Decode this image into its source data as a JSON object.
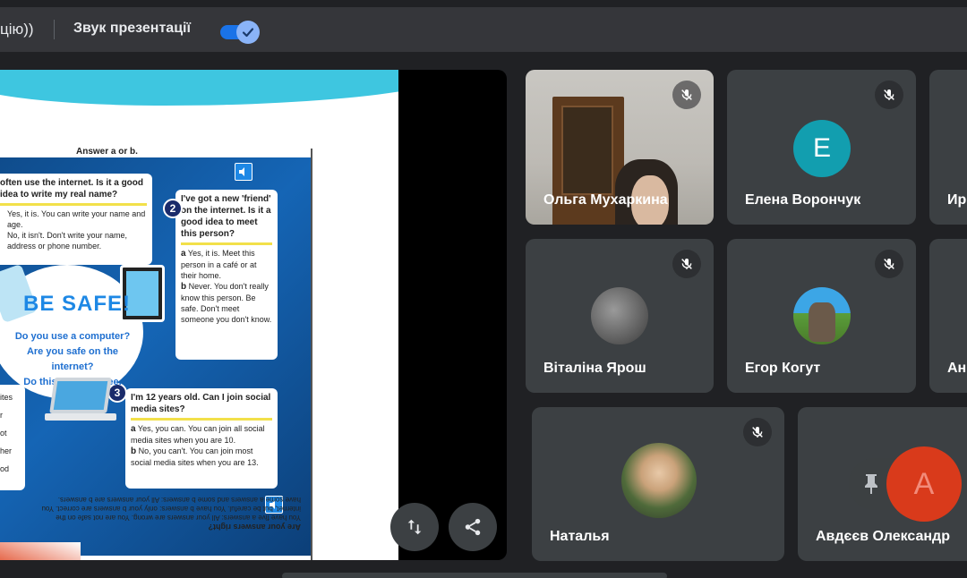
{
  "banner": {
    "tail_text": "цію))",
    "sound_label": "Звук презентації",
    "sound_enabled": true
  },
  "slide": {
    "instruction": "Answer a or b.",
    "q1": {
      "question": "often use the internet. Is it a good idea to write my real name?",
      "a": "Yes, it is. You can write your name and age.",
      "b": "No, it isn't. Don't write your name, address or phone number."
    },
    "q2": {
      "number": "2",
      "question": "I've got a new 'friend' on the internet. Is it a good idea to meet this person?",
      "a_label": "a",
      "a": "Yes, it is. Meet this person in a café or at their home.",
      "b_label": "b",
      "b": "Never. You don't really know this person. Be safe. Don't meet someone you don't know."
    },
    "q3": {
      "number": "3",
      "question": "I'm 12 years old. Can I join social media sites?",
      "a_label": "a",
      "a": "Yes, you can. You can join all social media sites when you are 10.",
      "b_label": "b",
      "b": "No, you can't. You can join most social media sites when you are 13."
    },
    "title": "BE SAFE!",
    "subtitle_lines": [
      "Do you use a computer?",
      "Are you safe on the internet?",
      "Do this quiz and see."
    ],
    "left_fragments": [
      "ites",
      "r",
      "ot",
      "her",
      "od"
    ],
    "speaker_top": "110",
    "speaker_bottom": "111",
    "flipped_title": "Are your answers right?",
    "flipped_text": "You have five a answers: All your answers are wrong. You are not safe on the internet, but be careful. You have b answers: only your b answers are correct. You have some a answers and some b answers: All your answers are b answers."
  },
  "controls": {
    "swap_icon": "swap-vertical-icon",
    "share_icon": "share-icon"
  },
  "participants": [
    {
      "name": "Ольга Мухаркина",
      "type": "video",
      "muted": true
    },
    {
      "name": "Елена Ворончук",
      "type": "initial",
      "initial": "E",
      "color": "#129eaf",
      "muted": true
    },
    {
      "name": "Ир",
      "type": "cut",
      "muted": false
    },
    {
      "name": "Віталіна Ярош",
      "type": "photo",
      "muted": true
    },
    {
      "name": "Егор Когут",
      "type": "photo",
      "muted": true
    },
    {
      "name": "Ан",
      "type": "cut",
      "muted": false
    },
    {
      "name": "Наталья",
      "type": "photo",
      "muted": true
    },
    {
      "name": "Авдєєв Олександр",
      "type": "presenter",
      "muted": false
    }
  ],
  "pin": {
    "pin_icon": "pin-icon",
    "avatar_letter": "A"
  }
}
